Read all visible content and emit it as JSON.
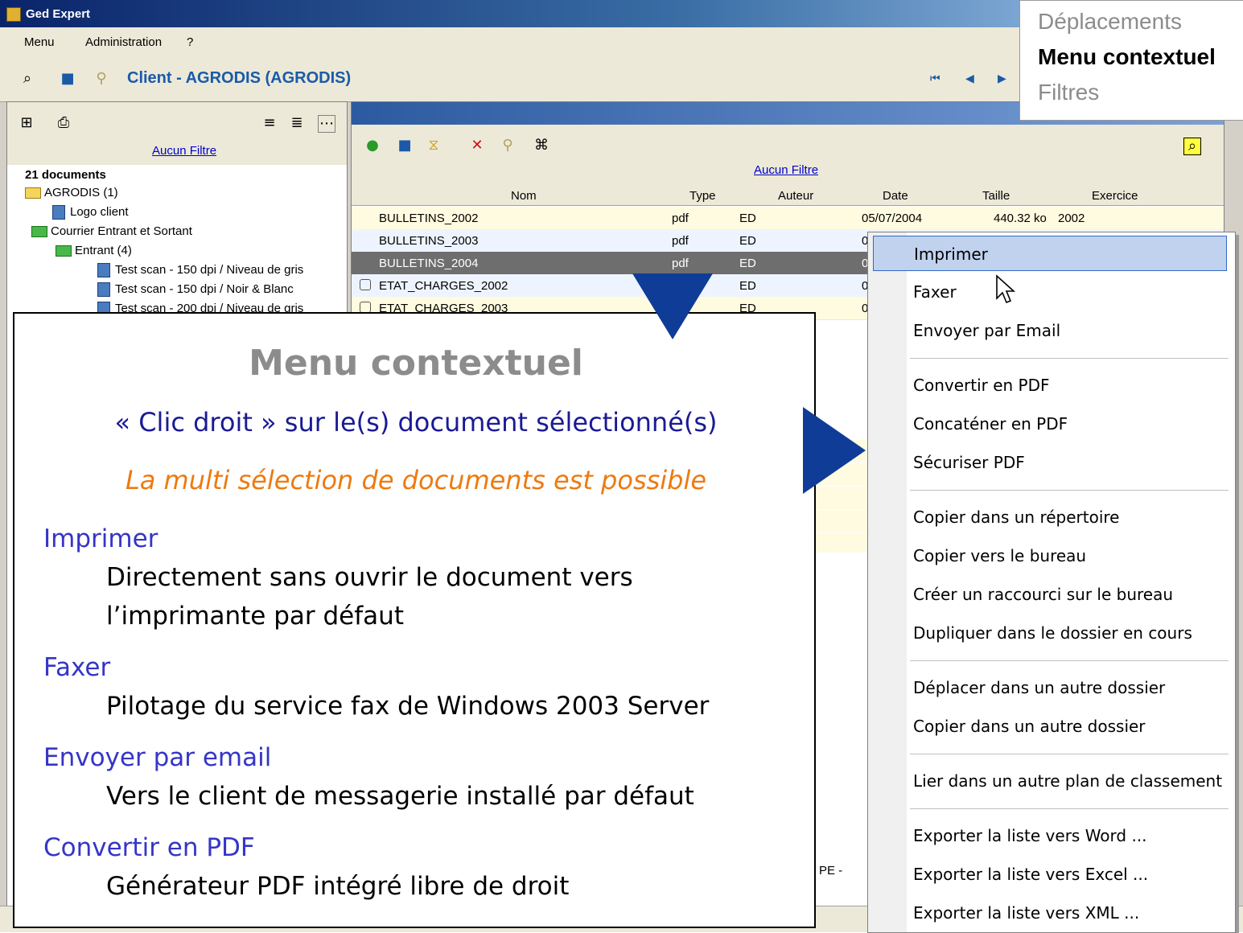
{
  "window": {
    "title": "Ged Expert"
  },
  "menu": {
    "items": [
      "Menu",
      "Administration",
      "?"
    ]
  },
  "toolbar": {
    "client_label": "Client - AGRODIS (AGRODIS)"
  },
  "left_panel": {
    "filter_link": "Aucun Filtre",
    "doc_count": "21 documents",
    "tree": [
      "AGRODIS (1)",
      "Logo client",
      "Courrier Entrant et Sortant",
      "Entrant (4)",
      "Test scan - 150 dpi / Niveau de gris",
      "Test scan - 150 dpi / Noir & Blanc",
      "Test scan - 200 dpi / Niveau de gris"
    ]
  },
  "grid": {
    "filter_link": "Aucun Filtre",
    "columns": [
      "Nom",
      "Type",
      "Auteur",
      "Date",
      "Taille",
      "Exercice"
    ],
    "rows": [
      {
        "nom": "BULLETINS_2002",
        "type": "pdf",
        "auteur": "ED",
        "date": "05/07/2004",
        "taille": "440.32 ko",
        "exercice": "2002"
      },
      {
        "nom": "BULLETINS_2003",
        "type": "pdf",
        "auteur": "ED",
        "date": "0"
      },
      {
        "nom": "BULLETINS_2004",
        "type": "pdf",
        "auteur": "ED",
        "date": "0"
      },
      {
        "nom": "ETAT_CHARGES_2002",
        "auteur": "ED",
        "date": "0"
      },
      {
        "nom": "ETAT_CHARGES_2003",
        "auteur": "ED",
        "date": "0"
      }
    ],
    "taskbar_item": "PE -"
  },
  "legend": {
    "items": [
      "Déplacements",
      "Menu contextuel",
      "Filtres"
    ],
    "active_index": 1,
    "active_color": "#000000",
    "inactive_color": "#8c8c8c"
  },
  "context_menu": {
    "items": [
      "Imprimer",
      "Faxer",
      "Envoyer par Email",
      "Convertir en PDF",
      "Concaténer en PDF",
      "Sécuriser PDF",
      "Copier dans un répertoire",
      "Copier vers le bureau",
      "Créer un raccourci sur le bureau",
      "Dupliquer dans le dossier en cours",
      "Déplacer dans un autre dossier",
      "Copier dans un autre dossier",
      "Lier dans un autre plan de classement",
      "Exporter la liste vers Word ...",
      "Exporter la liste vers Excel ...",
      "Exporter la liste vers XML ..."
    ],
    "highlighted": "Imprimer"
  },
  "callout": {
    "title": "Menu contextuel",
    "subtitle": "« Clic droit » sur le(s) document sélectionné(s)",
    "note": "La multi sélection de documents est possible",
    "features": [
      {
        "heading": "Imprimer",
        "desc": [
          "Directement sans ouvrir le document vers",
          "l’imprimante par défaut"
        ]
      },
      {
        "heading": "Faxer",
        "desc": [
          "Pilotage du service fax de Windows 2003 Server"
        ]
      },
      {
        "heading": "Envoyer par email",
        "desc": [
          "Vers le client de messagerie installé par défaut"
        ]
      },
      {
        "heading": "Convertir en PDF",
        "desc": [
          "Générateur PDF intégré libre de droit"
        ]
      }
    ],
    "arrow_color": "#0f3c96"
  }
}
